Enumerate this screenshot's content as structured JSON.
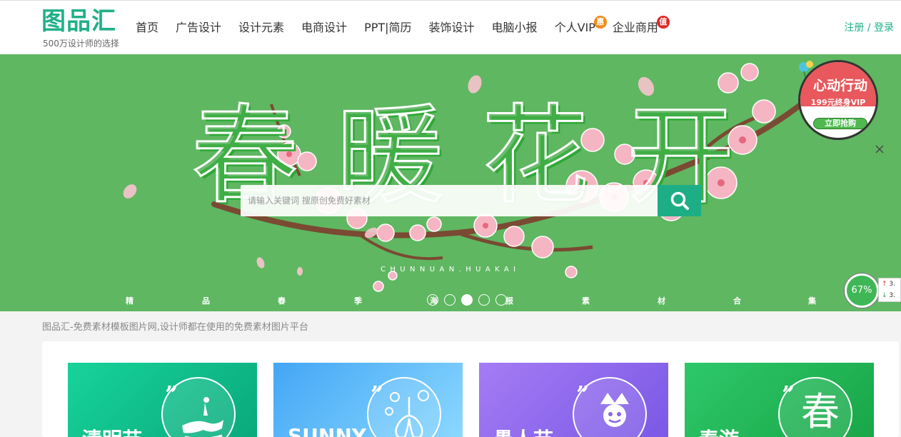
{
  "header": {
    "logo_text": "图品汇",
    "logo_slogan": "500万设计师的选择",
    "nav": [
      {
        "label": "首页"
      },
      {
        "label": "广告设计"
      },
      {
        "label": "设计元素"
      },
      {
        "label": "电商设计"
      },
      {
        "label": "PPT|简历"
      },
      {
        "label": "装饰设计"
      },
      {
        "label": "电脑小报"
      },
      {
        "label": "个人VIP",
        "badge": "惠",
        "badge_color": "#f08a19"
      },
      {
        "label": "企业商用",
        "badge": "值",
        "badge_color": "#e02828"
      }
    ],
    "register_label": "注册",
    "auth_separator": " / ",
    "login_label": "登录"
  },
  "banner": {
    "title_chars": [
      "春",
      "暖",
      "花",
      "开"
    ],
    "subtitle_en": "CHUNNUAN.HUAKAI",
    "caption_chars": [
      "精",
      "品",
      "春",
      "季",
      "海",
      "报",
      "素",
      "材",
      "合",
      "集"
    ],
    "search_placeholder": "请输入关键词 搜原创免费好素材",
    "search_icon": "search-icon",
    "carousel_count": 5,
    "carousel_active": 3,
    "bg_color": "#5fb761",
    "accent_color": "#1eae85"
  },
  "promo": {
    "title": "心动行动",
    "subtitle": "199元终身VIP",
    "button": "立即抢购",
    "close_icon": "close-icon"
  },
  "speed_widget": {
    "percent": "67%",
    "up_value": "3.",
    "down_value": "3.",
    "up_arrow": "↑",
    "down_arrow": "↓"
  },
  "site_tagline": "图品汇-免费素材模板图片网,设计师都在使用的免费素材图片平台",
  "cards": [
    {
      "label": "清明节",
      "quote": "”",
      "glyph": "",
      "icon": "horse-rider-icon",
      "color_from": "#17d39a",
      "color_to": "#0aa97b"
    },
    {
      "label": "SUNNY",
      "quote": "”",
      "glyph": "",
      "icon": "lungs-virus-icon",
      "color_from": "#43a6f5",
      "color_to": "#7fd0ff"
    },
    {
      "label": "愚人节",
      "quote": "”",
      "glyph": "",
      "icon": "jester-icon",
      "color_from": "#a47cf4",
      "color_to": "#7b58e6"
    },
    {
      "label": "春游",
      "quote": "”",
      "glyph": "春",
      "icon": "spring-char-icon",
      "color_from": "#2dc86a",
      "color_to": "#19a647"
    }
  ]
}
